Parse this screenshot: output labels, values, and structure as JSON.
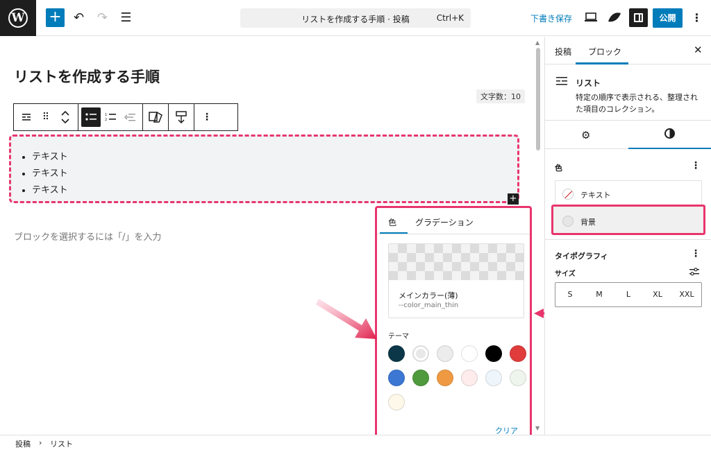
{
  "topbar": {
    "logo": "W",
    "add_icon": "+",
    "undo_icon": "↶",
    "redo_icon": "↷",
    "outline_icon": "☰",
    "command_title": "リストを作成する手順 · 投稿",
    "command_shortcut": "Ctrl+K",
    "save_draft": "下書き保存",
    "publish": "公開",
    "more_icon": "⋮"
  },
  "editor": {
    "post_title": "リストを作成する手順",
    "word_count": "文字数：10",
    "list_items": [
      "テキスト",
      "テキスト",
      "テキスト"
    ],
    "placeholder": "ブロックを選択するには「/」を入力",
    "inserter_icon": "+"
  },
  "block_toolbar": {
    "drag_icon": "⠿",
    "more_icon": "⋮"
  },
  "color_popover": {
    "tabs": [
      "色",
      "グラデーション"
    ],
    "selected_name": "メインカラー(薄)",
    "selected_var": "--color_main_thin",
    "theme_label": "テーマ",
    "clear": "クリア",
    "swatches": [
      "#0b3748",
      "#e8e8e8",
      "#ececec",
      "#ffffff",
      "#000000",
      "#e03c3c",
      "#3c77d4",
      "#4e9a3d",
      "#ef9a42",
      "#fdeceb",
      "#eef5fb",
      "#eef5ec",
      "#fdf8ea"
    ]
  },
  "sidebar": {
    "tabs": [
      "投稿",
      "ブロック"
    ],
    "close_icon": "✕",
    "block_name": "リスト",
    "block_desc": "特定の順序で表示される、整理された項目のコレクション。",
    "gear_icon": "⚙",
    "color_section": "色",
    "color_items": [
      "テキスト",
      "背景"
    ],
    "typo_section": "タイポグラフィ",
    "size_label": "サイズ",
    "sizes": [
      "S",
      "M",
      "L",
      "XL",
      "XXL"
    ]
  },
  "footer": {
    "crumbs": [
      "投稿",
      "リスト"
    ],
    "sep": "›"
  },
  "colors": {
    "accent": "#007cba",
    "highlight": "#e8356d"
  }
}
